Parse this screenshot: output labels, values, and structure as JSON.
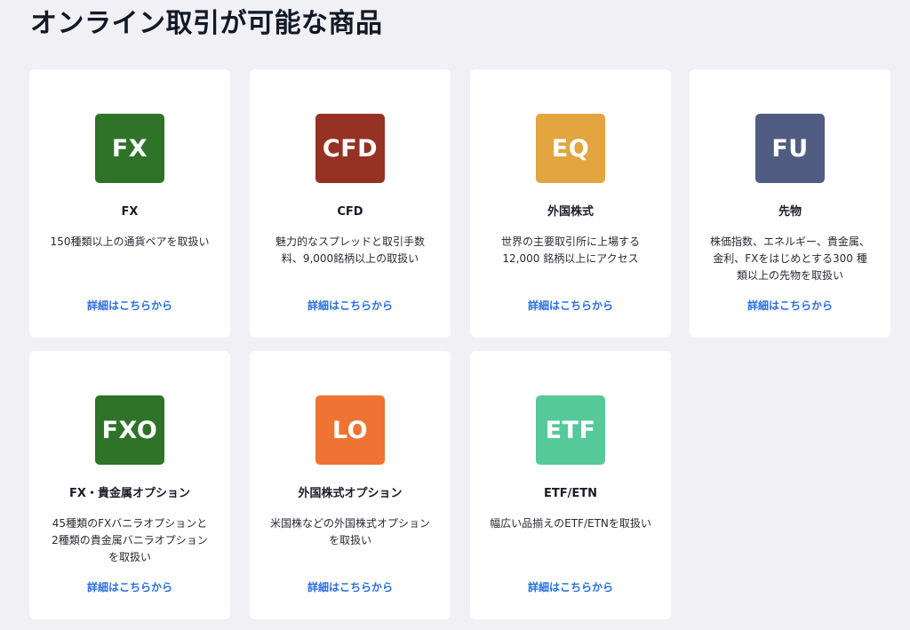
{
  "page": {
    "title": "オンライン取引が可能な商品"
  },
  "products": [
    {
      "icon_text": "FX",
      "icon_color": "#2e7328",
      "name": "FX",
      "description": "150種類以上の通貨ペアを取扱い",
      "link": "詳細はこちらから"
    },
    {
      "icon_text": "CFD",
      "icon_color": "#963224",
      "name": "CFD",
      "description": "魅力的なスプレッドと取引手数料、9,000銘柄以上の取扱い",
      "link": "詳細はこちらから"
    },
    {
      "icon_text": "EQ",
      "icon_color": "#e3a53f",
      "name": "外国株式",
      "description": "世界の主要取引所に上場する12,000 銘柄以上にアクセス",
      "link": "詳細はこちらから"
    },
    {
      "icon_text": "FU",
      "icon_color": "#515c83",
      "name": "先物",
      "description": "株価指数、エネルギー、貴金属、金利、FXをはじめとする300 種類以上の先物を取扱い",
      "link": "詳細はこちらから"
    },
    {
      "icon_text": "FXO",
      "icon_color": "#2e7328",
      "name": "FX・貴金属オプション",
      "description": "45種類のFXバニラオプションと2種類の貴金属バニラオプションを取扱い",
      "link": "詳細はこちらから"
    },
    {
      "icon_text": "LO",
      "icon_color": "#ef7433",
      "name": "外国株式オプション",
      "description": "米国株などの外国株式オプションを取扱い",
      "link": "詳細はこちらから"
    },
    {
      "icon_text": "ETF",
      "icon_color": "#56c998",
      "name": "ETF/ETN",
      "description": "幅広い品揃えのETF/ETNを取扱い",
      "link": "詳細はこちらから"
    }
  ]
}
